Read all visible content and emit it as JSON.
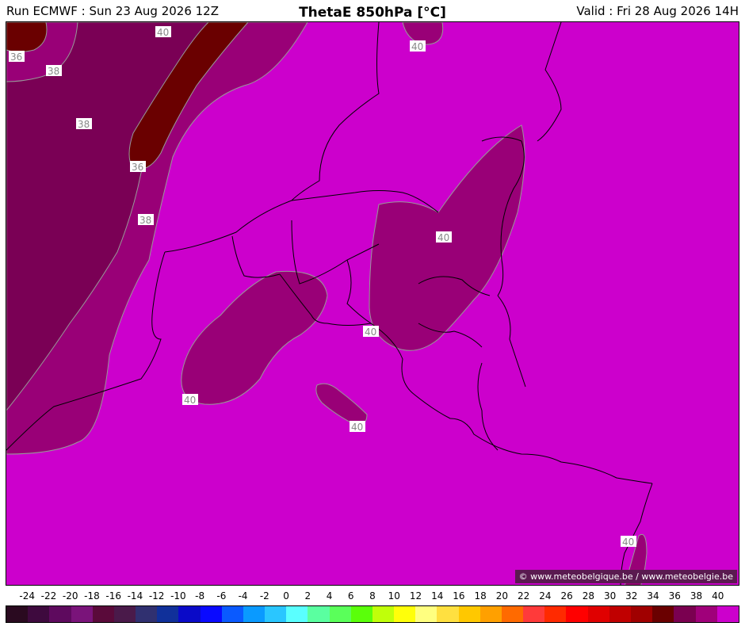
{
  "header": {
    "run": "Run ECMWF : Sun 23 Aug 2026 12Z",
    "title": "ThetaE 850hPa [°C]",
    "valid": "Valid : Fri 28 Aug 2026 14H"
  },
  "credit": "© www.meteobelgique.be / www.meteobelgie.be",
  "contour_labels": [
    "36",
    "38",
    "40"
  ],
  "legend": {
    "ticks": [
      "-24",
      "-22",
      "-20",
      "-18",
      "-16",
      "-14",
      "-12",
      "-10",
      "-8",
      "-6",
      "-4",
      "-2",
      "0",
      "2",
      "4",
      "6",
      "8",
      "10",
      "12",
      "14",
      "16",
      "18",
      "20",
      "22",
      "24",
      "26",
      "28",
      "30",
      "32",
      "34",
      "36",
      "38",
      "40"
    ],
    "colors": [
      "#2a0a20",
      "#3e0a3e",
      "#5e0a5e",
      "#7a147a",
      "#5a0a3a",
      "#4a1a4a",
      "#303070",
      "#10309a",
      "#0a0ac8",
      "#0a0aff",
      "#0a5aff",
      "#0a9aff",
      "#2ac6ff",
      "#5affff",
      "#5affa0",
      "#5aff5a",
      "#5aff0a",
      "#c0ff0a",
      "#ffff0a",
      "#ffff80",
      "#ffe040",
      "#ffc800",
      "#ffa000",
      "#ff6a00",
      "#ff3a3a",
      "#ff2a00",
      "#ff0000",
      "#e00000",
      "#c00000",
      "#a00000",
      "#6a0000",
      "#7a0050",
      "#a0007a",
      "#cc00cc"
    ]
  },
  "colors": {
    "field_40": "#cc00cc",
    "field_38": "#990077",
    "field_36": "#7a0055",
    "field_34": "#6a0000"
  }
}
